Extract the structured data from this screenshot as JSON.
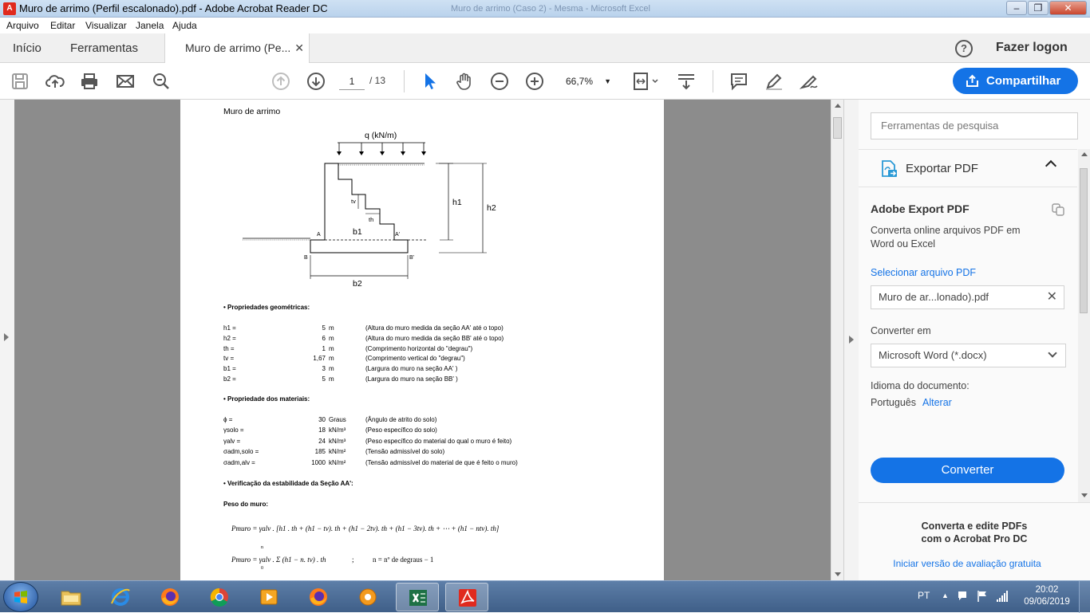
{
  "window": {
    "title": "Muro de arrimo (Perfil escalonado).pdf - Adobe Acrobat Reader DC",
    "ghost_title": "Muro de arrimo (Caso 2) - Mesma - Microsoft Excel",
    "app_icon": "adobe-acrobat-icon"
  },
  "menu": {
    "file": "Arquivo",
    "edit": "Editar",
    "view": "Visualizar",
    "window": "Janela",
    "help": "Ajuda"
  },
  "tabs": {
    "home": "Início",
    "tools": "Ferramentas",
    "doc": "Muro de arrimo (Pe...",
    "close": "✕"
  },
  "header": {
    "help": "?",
    "login": "Fazer logon"
  },
  "toolbar": {
    "page_current": "1",
    "page_total": "/ 13",
    "zoom": "66,7%",
    "share": "Compartilhar"
  },
  "document": {
    "heading": "Muro de arrimo",
    "diagram": {
      "load": "q (kN/m)",
      "tv": "tv",
      "th": "th",
      "b1": "b1",
      "b2": "b2",
      "h1": "h1",
      "h2": "h2",
      "A": "A",
      "A2": "A'",
      "B": "B",
      "B2": "B'"
    },
    "geom_title": "• Propriedades geométricas:",
    "geom": [
      {
        "name": "h1 =",
        "value": "5",
        "unit": "m",
        "desc": "(Altura do muro medida da seção AA' até o topo)"
      },
      {
        "name": "h2 =",
        "value": "6",
        "unit": "m",
        "desc": "(Altura do muro medida da seção BB' até o topo)"
      },
      {
        "name": "th =",
        "value": "1",
        "unit": "m",
        "desc": "(Comprimento horizontal do \"degrau\")"
      },
      {
        "name": "tv =",
        "value": "1,67",
        "unit": "m",
        "desc": "(Comprimento vertical do \"degrau\")"
      },
      {
        "name": "b1 =",
        "value": "3",
        "unit": "m",
        "desc": "(Largura do muro na seção AA' )"
      },
      {
        "name": "b2 =",
        "value": "5",
        "unit": "m",
        "desc": "(Largura do muro na seção BB' )"
      }
    ],
    "mat_title": "• Propriedade dos materiais:",
    "mat": [
      {
        "name": "ϕ =",
        "value": "30",
        "unit": "Graus",
        "desc": "(Ângulo de atrito do solo)"
      },
      {
        "name": "γsolo =",
        "value": "18",
        "unit": "kN/m³",
        "desc": "(Peso específico do solo)"
      },
      {
        "name": "γalv =",
        "value": "24",
        "unit": "kN/m³",
        "desc": "(Peso específico do material do qual o muro é feito)"
      },
      {
        "name": "σadm,solo =",
        "value": "185",
        "unit": "kN/m²",
        "desc": "(Tensão admissível do solo)"
      },
      {
        "name": "σadm,alv =",
        "value": "1000",
        "unit": "kN/m²",
        "desc": "(Tensão admissível do material de que é feito o muro)"
      }
    ],
    "verif_title": "• Verificação da estabilidade da Seção AA':",
    "peso_title": "Peso do muro:",
    "eq1": "Pmuro = γalv . [h1 . th + (h1 − tv). th + (h1 − 2tv). th + (h1 − 3tv). th + ⋯ + (h1 − ntv). th]",
    "eq2": "Pmuro = γalv . Σ (h1 − n. tv) . th",
    "eq2_top": "n",
    "eq2_bottom": "0",
    "eq2_sep": ";",
    "eq2_note": "n = nº de degraus − 1"
  },
  "panel": {
    "search_placeholder": "Ferramentas de pesquisa",
    "section": "Exportar PDF",
    "title": "Adobe Export PDF",
    "desc": "Converta online arquivos PDF em Word ou Excel",
    "select_file": "Selecionar arquivo PDF",
    "file": "Muro de ar...lonado).pdf",
    "convert_to_label": "Converter em",
    "convert_to": "Microsoft Word (*.docx)",
    "lang_label": "Idioma do documento:",
    "lang": "Português",
    "change": "Alterar",
    "convert_btn": "Converter",
    "promo1": "Converta e edite PDFs",
    "promo2": "com o Acrobat Pro DC",
    "trial": "Iniciar versão de avaliação gratuita"
  },
  "taskbar": {
    "lang": "PT",
    "time": "20:02",
    "date": "09/06/2019"
  },
  "colors": {
    "accent": "#1473e6",
    "doc_bg": "#8c8c8c",
    "adobe_red": "#e02a1e"
  }
}
